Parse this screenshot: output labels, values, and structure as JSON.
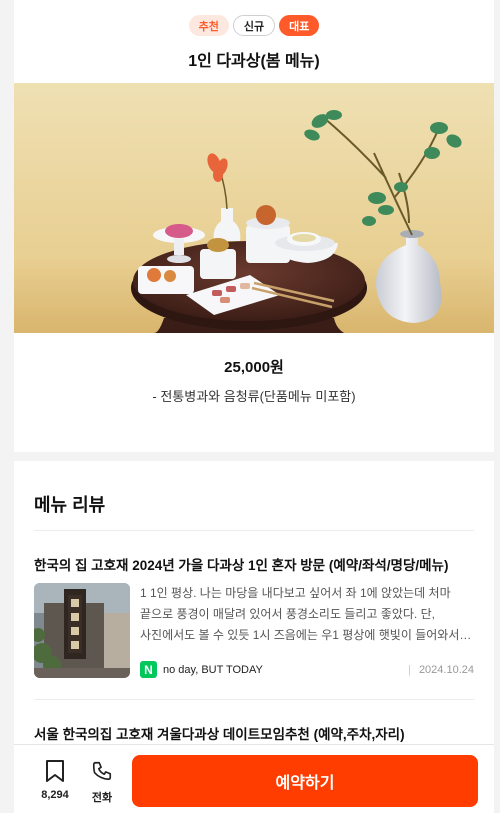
{
  "menu": {
    "badges": [
      "추천",
      "신규",
      "대표"
    ],
    "title": "1인 다과상(봄 메뉴)",
    "price": "25,000원",
    "description": "- 전통병과와 음청류(단품메뉴 미포함)"
  },
  "reviews": {
    "section_title": "메뉴 리뷰",
    "items": [
      {
        "title": "한국의 집 고호재 2024년 가을 다과상 1인 혼자 방문 (예약/좌석/명당/메뉴)",
        "excerpt": "1 1인 평상. 나는 마당을 내다보고 싶어서 좌 1에 앉았는데 처마 끝으로 풍경이 매달려 있어서 풍경소리도 들리고 좋았다. 단, 사진에서도 볼 수 있듯 1시 즈음에는 우1 평상에 햇빛이 들어와서 사진...",
        "source_logo": "N",
        "source": "no day, BUT TODAY",
        "date": "2024.10.24"
      },
      {
        "title": "서울 한국의집 고호재 겨울다과상 데이트모임추천 (예약,주차,자리)"
      }
    ]
  },
  "bottom_bar": {
    "bookmark_count": "8,294",
    "call_label": "전화",
    "reserve_label": "예약하기"
  },
  "colors": {
    "accent": "#ff3d00",
    "badge_orange": "#ff5a2a",
    "naver_green": "#03c75a"
  }
}
